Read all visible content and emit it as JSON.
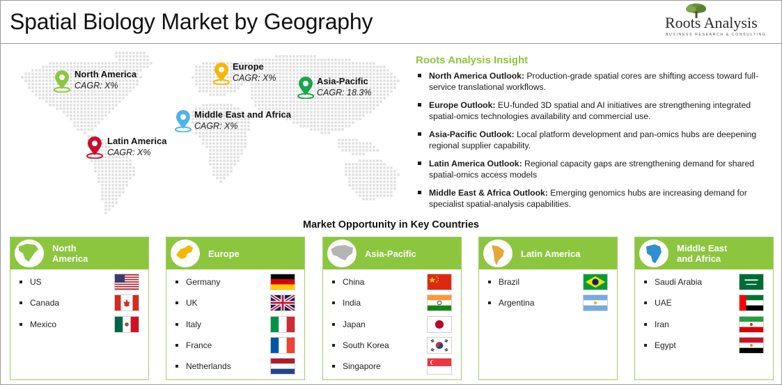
{
  "header": {
    "title": "Spatial Biology Market by Geography",
    "logo_name": "Roots Analysis",
    "logo_tagline": "BUSINESS RESEARCH & CONSULTING"
  },
  "map": {
    "regions": [
      {
        "name": "North America",
        "cagr": "CAGR: X%",
        "pin_color": "#8cc63f"
      },
      {
        "name": "Europe",
        "cagr": "CAGR: X%",
        "pin_color": "#f5b800"
      },
      {
        "name": "Asia-Pacific",
        "cagr": "CAGR: 18.3%",
        "pin_color": "#1aa64a"
      },
      {
        "name": "Middle East and Africa",
        "cagr": "CAGR: X%",
        "pin_color": "#4fb3e8"
      },
      {
        "name": "Latin America",
        "cagr": "CAGR: X%",
        "pin_color": "#c8102e"
      }
    ]
  },
  "insight": {
    "title": "Roots Analysis Insight",
    "items": [
      {
        "heading": "North America Outlook:",
        "text": " Production-grade spatial cores are shifting access toward full-service translational workflows."
      },
      {
        "heading": "Europe Outlook:",
        "text": " EU-funded 3D spatial and AI initiatives are strengthening integrated spatial-omics technologies availability and commercial use."
      },
      {
        "heading": "Asia-Pacific Outlook:",
        "text": " Local platform development and pan-omics hubs are deepening regional supplier capability."
      },
      {
        "heading": "Latin America Outlook:",
        "text": " Regional capacity gaps are strengthening demand for shared spatial-omics access models"
      },
      {
        "heading": "Middle East & Africa Outlook:",
        "text": " Emerging genomics hubs are increasing demand for specialist spatial-analysis capabilities."
      }
    ]
  },
  "opportunity": {
    "title": "Market Opportunity in Key Countries",
    "cards": [
      {
        "region": "North America",
        "label_line1": "North",
        "label_line2": "America",
        "icon": "north-america-map-icon",
        "countries": [
          {
            "name": "US",
            "flag": "us"
          },
          {
            "name": "Canada",
            "flag": "ca"
          },
          {
            "name": "Mexico",
            "flag": "mx"
          }
        ]
      },
      {
        "region": "Europe",
        "label_line1": "Europe",
        "label_line2": "",
        "icon": "europe-map-icon",
        "countries": [
          {
            "name": "Germany",
            "flag": "de"
          },
          {
            "name": "UK",
            "flag": "gb"
          },
          {
            "name": "Italy",
            "flag": "it"
          },
          {
            "name": "France",
            "flag": "fr"
          },
          {
            "name": "Netherlands",
            "flag": "nl"
          }
        ]
      },
      {
        "region": "Asia-Pacific",
        "label_line1": "Asia-Pacific",
        "label_line2": "",
        "icon": "asia-map-icon",
        "countries": [
          {
            "name": "China",
            "flag": "cn"
          },
          {
            "name": "India",
            "flag": "in"
          },
          {
            "name": "Japan",
            "flag": "jp"
          },
          {
            "name": "South Korea",
            "flag": "kr"
          },
          {
            "name": "Singapore",
            "flag": "sg"
          }
        ]
      },
      {
        "region": "Latin America",
        "label_line1": "Latin America",
        "label_line2": "",
        "icon": "latin-america-map-icon",
        "countries": [
          {
            "name": "Brazil",
            "flag": "br"
          },
          {
            "name": "Argentina",
            "flag": "ar"
          }
        ]
      },
      {
        "region": "Middle East and Africa",
        "label_line1": "Middle East",
        "label_line2": "and Africa",
        "icon": "africa-map-icon",
        "countries": [
          {
            "name": "Saudi Arabia",
            "flag": "sa"
          },
          {
            "name": "UAE",
            "flag": "ae"
          },
          {
            "name": "Iran",
            "flag": "ir"
          },
          {
            "name": "Egypt",
            "flag": "eg"
          }
        ]
      }
    ]
  },
  "colors": {
    "accent_green": "#8cc63f",
    "card_border": "#9fce68"
  }
}
